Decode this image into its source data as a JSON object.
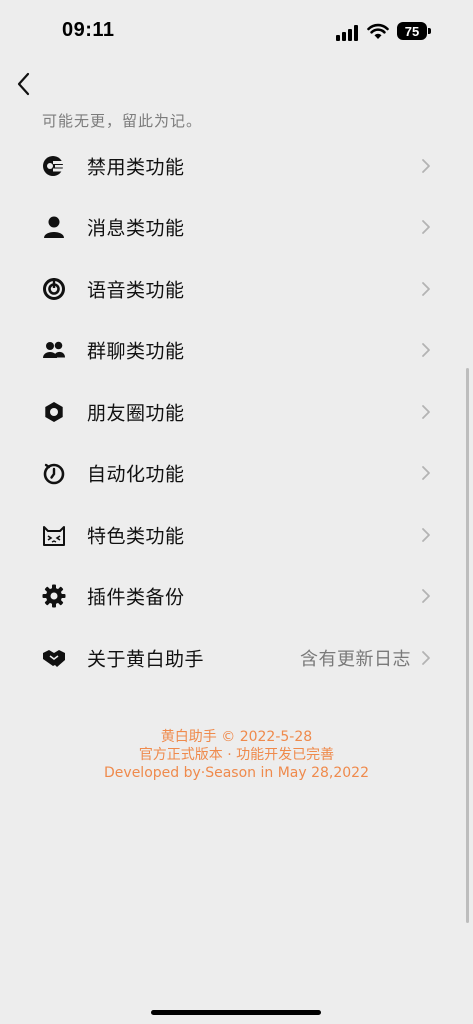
{
  "status_bar": {
    "time": "09:11",
    "battery": "75"
  },
  "header": {
    "back_icon": "chevron-left-icon",
    "subtitle": "可能无更，留此为记。"
  },
  "menu": [
    {
      "id": "ban",
      "label": "禁用类功能",
      "value": "",
      "icon": "ban-features-icon"
    },
    {
      "id": "message",
      "label": "消息类功能",
      "value": "",
      "icon": "person-icon"
    },
    {
      "id": "voice",
      "label": "语音类功能",
      "value": "",
      "icon": "voice-icon"
    },
    {
      "id": "group",
      "label": "群聊类功能",
      "value": "",
      "icon": "group-icon"
    },
    {
      "id": "moments",
      "label": "朋友圈功能",
      "value": "",
      "icon": "moments-icon"
    },
    {
      "id": "auto",
      "label": "自动化功能",
      "value": "",
      "icon": "timer-icon"
    },
    {
      "id": "special",
      "label": "特色类功能",
      "value": "",
      "icon": "cat-icon"
    },
    {
      "id": "plugin",
      "label": "插件类备份",
      "value": "",
      "icon": "gear-icon"
    },
    {
      "id": "about",
      "label": "关于黄白助手",
      "value": "含有更新日志",
      "icon": "handshake-icon"
    }
  ],
  "footer": {
    "line1": "黄白助手 © 2022-5-28",
    "line2": "官方正式版本 · 功能开发已完善",
    "line3": "Developed by·Season in May 28,2022",
    "color": "#ef8a4c"
  }
}
